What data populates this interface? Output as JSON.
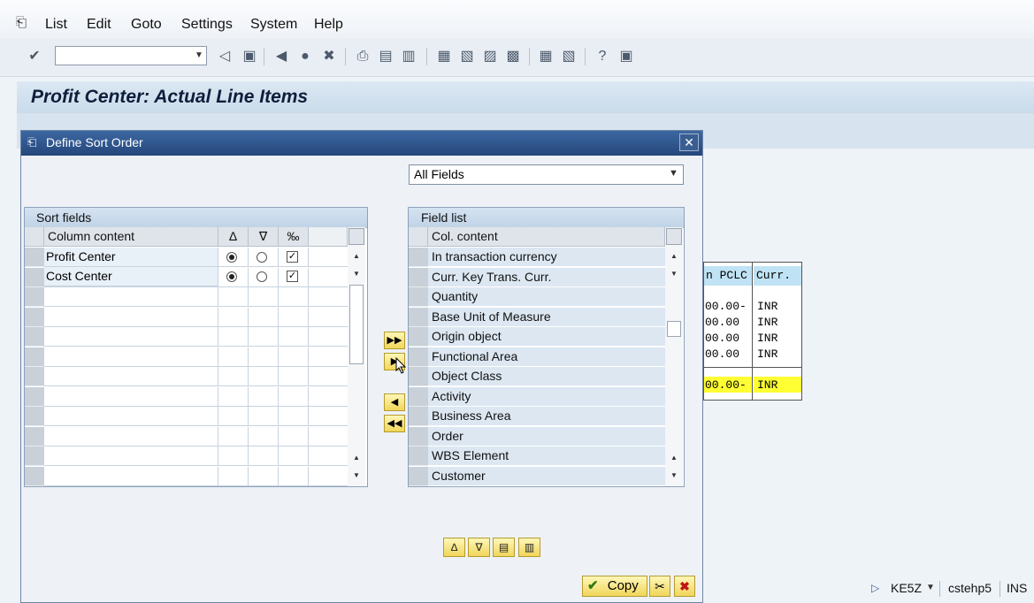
{
  "menu": {
    "items": [
      "List",
      "Edit",
      "Goto",
      "Settings",
      "System",
      "Help"
    ]
  },
  "page": {
    "title": "Profit Center: Actual Line Items"
  },
  "background_list": {
    "headers": [
      "n PCLC",
      "Curr."
    ],
    "amounts": [
      "00.00-",
      "00.00",
      "00.00",
      "00.00"
    ],
    "currencies": [
      "INR",
      "INR",
      "INR",
      "INR"
    ],
    "total_amount": "00.00-",
    "total_currency": "INR"
  },
  "dialog": {
    "title": "Define Sort Order",
    "field_filter": "All Fields",
    "sort_fields": {
      "title": "Sort fields",
      "column_header": "Column content",
      "rows": [
        {
          "label": "Profit Center",
          "ascending": true,
          "checked": true
        },
        {
          "label": "Cost Center",
          "ascending": true,
          "checked": true
        }
      ]
    },
    "field_list": {
      "title": "Field list",
      "column_header": "Col. content",
      "items": [
        "In transaction currency",
        "Curr. Key Trans. Curr.",
        "Quantity",
        "Base Unit of Measure",
        "Origin object",
        "Functional Area",
        "Object Class",
        "Activity",
        "Business Area",
        "Order",
        "WBS Element",
        "Customer"
      ]
    },
    "copy_label": "Copy"
  },
  "status": {
    "transaction": "KE5Z",
    "server": "cstehp5",
    "mode": "INS"
  },
  "colors": {
    "title_bar": "#2f5a93",
    "button_yellow": "#f0d65a",
    "total_highlight": "#ffff33",
    "header_highlight": "#bfe3f4"
  }
}
